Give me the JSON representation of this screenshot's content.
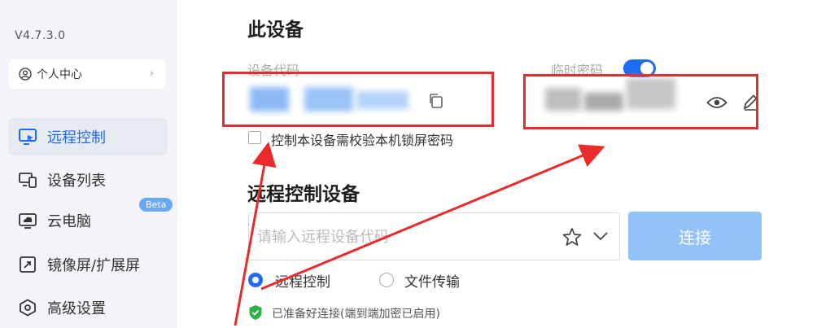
{
  "sidebar": {
    "version": "V4.7.3.0",
    "user_center": "个人中心",
    "beta_badge": "Beta",
    "items": [
      {
        "label": "远程控制",
        "icon": "remote-control-icon"
      },
      {
        "label": "设备列表",
        "icon": "device-list-icon"
      },
      {
        "label": "云电脑",
        "icon": "cloud-pc-icon"
      },
      {
        "label": "镜像屏/扩展屏",
        "icon": "mirror-screen-icon"
      },
      {
        "label": "高级设置",
        "icon": "settings-icon"
      }
    ]
  },
  "this_device": {
    "title": "此设备",
    "code_label": "设备代码",
    "temp_password_label": "临时密码",
    "temp_password_enabled": true,
    "verify_lock_password": "控制本设备需校验本机锁屏密码"
  },
  "remote": {
    "title": "远程控制设备",
    "input_placeholder": "请输入远程设备代码",
    "connect_button": "连接",
    "modes": [
      "远程控制",
      "文件传输"
    ],
    "selected_mode": "远程控制",
    "status": "已准备好连接(端到端加密已启用)"
  },
  "colors": {
    "accent": "#1f6cf4",
    "annotation": "#ea2b2b"
  }
}
